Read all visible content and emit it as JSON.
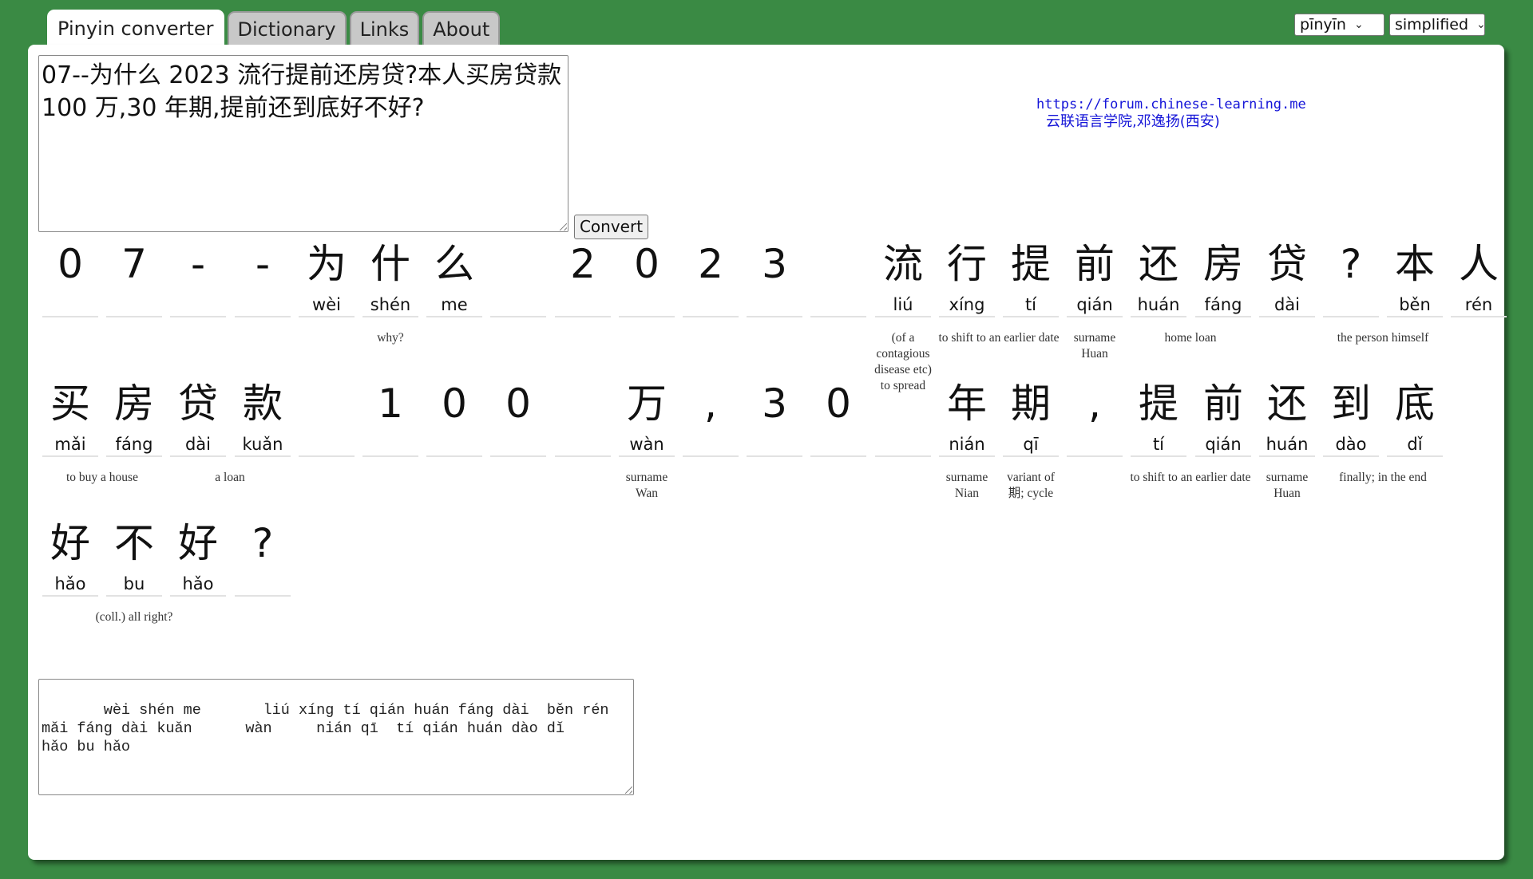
{
  "tabs": [
    "Pinyin converter",
    "Dictionary",
    "Links",
    "About"
  ],
  "selects": {
    "romanization": "pīnyīn",
    "script": "simplified"
  },
  "input_text": "07--为什么 2023 流行提前还房贷?本人买房贷款 100 万,30 年期,提前还到底好不好?",
  "convert_label": "Convert",
  "site": {
    "url": "https://forum.chinese-learning.me",
    "name": "云联语言学院,邓逸扬(西安)"
  },
  "rows": [
    {
      "cells": [
        {
          "hz": "0",
          "py": ""
        },
        {
          "hz": "7",
          "py": ""
        },
        {
          "hz": "-",
          "py": ""
        },
        {
          "hz": "-",
          "py": ""
        },
        {
          "hz": "为",
          "py": "wèi"
        },
        {
          "hz": "什",
          "py": "shén"
        },
        {
          "hz": "么",
          "py": "me"
        },
        {
          "hz": "",
          "py": ""
        },
        {
          "hz": "2",
          "py": ""
        },
        {
          "hz": "0",
          "py": ""
        },
        {
          "hz": "2",
          "py": ""
        },
        {
          "hz": "3",
          "py": ""
        },
        {
          "hz": "",
          "py": ""
        },
        {
          "hz": "流",
          "py": "liú"
        },
        {
          "hz": "行",
          "py": "xíng"
        },
        {
          "hz": "提",
          "py": "tí"
        },
        {
          "hz": "前",
          "py": "qián"
        },
        {
          "hz": "还",
          "py": "huán"
        },
        {
          "hz": "房",
          "py": "fáng"
        },
        {
          "hz": "贷",
          "py": "dài"
        },
        {
          "hz": "?",
          "py": ""
        },
        {
          "hz": "本",
          "py": "běn"
        },
        {
          "hz": "人",
          "py": "rén"
        }
      ],
      "defs": [
        {
          "text": "why?",
          "start": 4,
          "span": 3
        },
        {
          "text": "(of a contagious disease etc) to spread",
          "start": 13,
          "span": 1
        },
        {
          "text": "to shift to an earlier date",
          "start": 14,
          "span": 2
        },
        {
          "text": "surname Huan",
          "start": 16,
          "span": 1
        },
        {
          "text": "home loan",
          "start": 17,
          "span": 2
        },
        {
          "text": "the person himself",
          "start": 20,
          "span": 2
        }
      ]
    },
    {
      "cells": [
        {
          "hz": "买",
          "py": "mǎi"
        },
        {
          "hz": "房",
          "py": "fáng"
        },
        {
          "hz": "贷",
          "py": "dài"
        },
        {
          "hz": "款",
          "py": "kuǎn"
        },
        {
          "hz": "",
          "py": ""
        },
        {
          "hz": "1",
          "py": ""
        },
        {
          "hz": "0",
          "py": ""
        },
        {
          "hz": "0",
          "py": ""
        },
        {
          "hz": "",
          "py": ""
        },
        {
          "hz": "万",
          "py": "wàn"
        },
        {
          "hz": ",",
          "py": ""
        },
        {
          "hz": "3",
          "py": ""
        },
        {
          "hz": "0",
          "py": ""
        },
        {
          "hz": "",
          "py": ""
        },
        {
          "hz": "年",
          "py": "nián"
        },
        {
          "hz": "期",
          "py": "qī"
        },
        {
          "hz": ",",
          "py": ""
        },
        {
          "hz": "提",
          "py": "tí"
        },
        {
          "hz": "前",
          "py": "qián"
        },
        {
          "hz": "还",
          "py": "huán"
        },
        {
          "hz": "到",
          "py": "dào"
        },
        {
          "hz": "底",
          "py": "dǐ"
        }
      ],
      "defs": [
        {
          "text": "to buy a house",
          "start": 0,
          "span": 2
        },
        {
          "text": "a loan",
          "start": 2,
          "span": 2
        },
        {
          "text": "surname Wan",
          "start": 9,
          "span": 1
        },
        {
          "text": "surname Nian",
          "start": 14,
          "span": 1
        },
        {
          "text": "variant of 期; cycle",
          "start": 15,
          "span": 1
        },
        {
          "text": "to shift to an earlier date",
          "start": 17,
          "span": 2
        },
        {
          "text": "surname Huan",
          "start": 19,
          "span": 1
        },
        {
          "text": "finally; in the end",
          "start": 20,
          "span": 2
        }
      ]
    },
    {
      "cells": [
        {
          "hz": "好",
          "py": "hǎo"
        },
        {
          "hz": "不",
          "py": "bu"
        },
        {
          "hz": "好",
          "py": "hǎo"
        },
        {
          "hz": "?",
          "py": ""
        }
      ],
      "defs": [
        {
          "text": "(coll.) all right?",
          "start": 0,
          "span": 3
        }
      ]
    }
  ],
  "output_text": "   wèi shén me       liú xíng tí qián huán fáng dài  běn rén\nmǎi fáng dài kuǎn      wàn     nián qī  tí qián huán dào dǐ\nhǎo bu hǎo"
}
